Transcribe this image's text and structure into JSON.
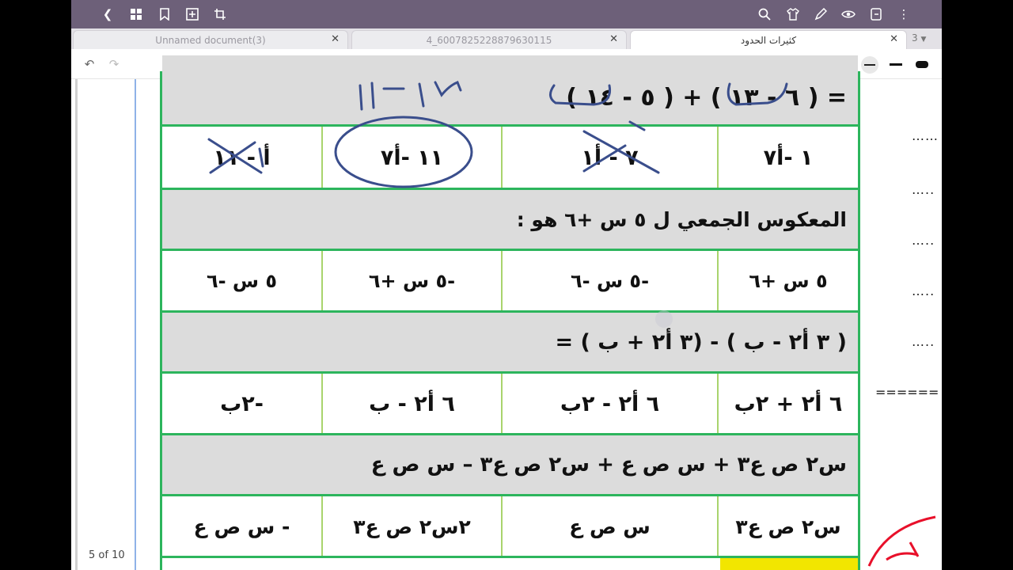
{
  "topbar": {
    "icons": [
      "back-icon",
      "grid-icon",
      "bookmark-icon",
      "add-page-icon",
      "crop-icon",
      "search-icon",
      "shirt-icon",
      "pen-edit-icon",
      "eye-icon",
      "export-icon",
      "more-icon"
    ]
  },
  "tabs": [
    {
      "label": "Unnamed document(3)",
      "active": false
    },
    {
      "label": "4_6007825228879630115",
      "active": false
    },
    {
      "label": "كثيرات الحدود",
      "active": true
    }
  ],
  "tab_count": "3",
  "toolbar": {
    "tools": [
      "undo-icon",
      "redo-icon",
      "pen-icon",
      "pencil-icon",
      "fountain-pen-icon",
      "highlighter-icon",
      "eraser-icon",
      "lasso-icon",
      "image-icon",
      "text-icon",
      "ocr-icon",
      "text-recognize-icon",
      "microphone-icon",
      "shape-icon",
      "laser-icon",
      "translate-icon"
    ],
    "colors": [
      "#333333",
      "#3a4e8c",
      "#e8102a"
    ]
  },
  "worksheet": {
    "row0_question": "= ( ٦ - ١٣ ) + ( ٥ - ١٤ )",
    "row1_answers": [
      "١ -أ٧",
      "٧ - أ١",
      "١١ -أ٧",
      "أ - ١١"
    ],
    "row2_question": "المعكوس الجمعي ل  ٥ س +٦  هو :",
    "row2_answers": [
      "٥ س +٦",
      "-٥ س -٦",
      "-٥ س +٦",
      "٥ س -٦"
    ],
    "row3_question": "( ٣ أ٢ - ب ) - (٣ أ٢ + ب ) =",
    "row3_answers": [
      "٦ أ٢ + ٢ب",
      "٦ أ٢ - ٢ب",
      "٦ أ٢ - ب",
      "-٢ب"
    ],
    "row4_question": "س٢ ص ع٣ + س ص ع + س٢ ص ع٣ – س ص ع",
    "row4_answers": [
      "س٢ ص ع٣",
      "س ص ع",
      "٢س٢ ص ع٣",
      "- س ص ع"
    ]
  },
  "right_margin": {
    "dots": [
      "……",
      "…..",
      "…..",
      "…..",
      "…..",
      "======"
    ]
  },
  "page_indicator": "5 of 10"
}
